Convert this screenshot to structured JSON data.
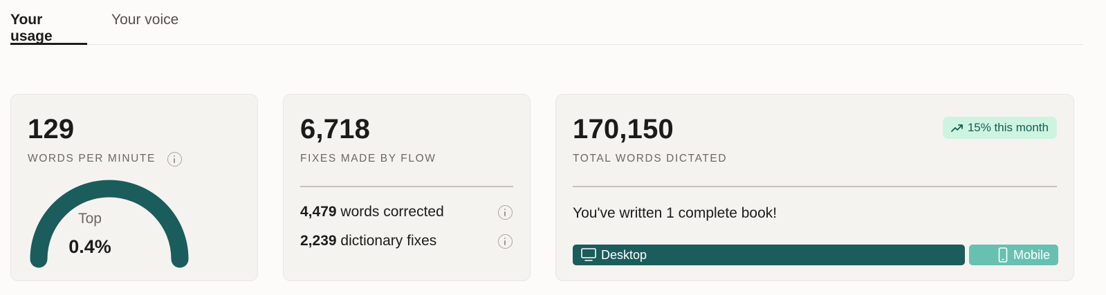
{
  "tabs": [
    {
      "label": "Your usage",
      "active": true
    },
    {
      "label": "Your voice",
      "active": false
    }
  ],
  "wpm_card": {
    "value": "129",
    "label": "WORDS PER MINUTE",
    "gauge_caption": "Top",
    "gauge_value": "0.4%",
    "info_icon": "info-icon",
    "gauge_color": "#1b5c5c"
  },
  "fixes_card": {
    "value": "6,718",
    "label": "FIXES MADE BY FLOW",
    "rows": [
      {
        "count": "4,479",
        "text": "words corrected"
      },
      {
        "count": "2,239",
        "text": "dictionary fixes"
      }
    ]
  },
  "words_card": {
    "value": "170,150",
    "label": "TOTAL WORDS DICTATED",
    "trend_badge": "15% this month",
    "trend_icon": "trending-up-icon",
    "book_text": "You've written 1 complete book!",
    "platforms": [
      {
        "label": "Desktop",
        "icon": "desktop-icon",
        "color": "#1b5c5c"
      },
      {
        "label": "Mobile",
        "icon": "mobile-icon",
        "color": "#68c0b1"
      }
    ]
  }
}
